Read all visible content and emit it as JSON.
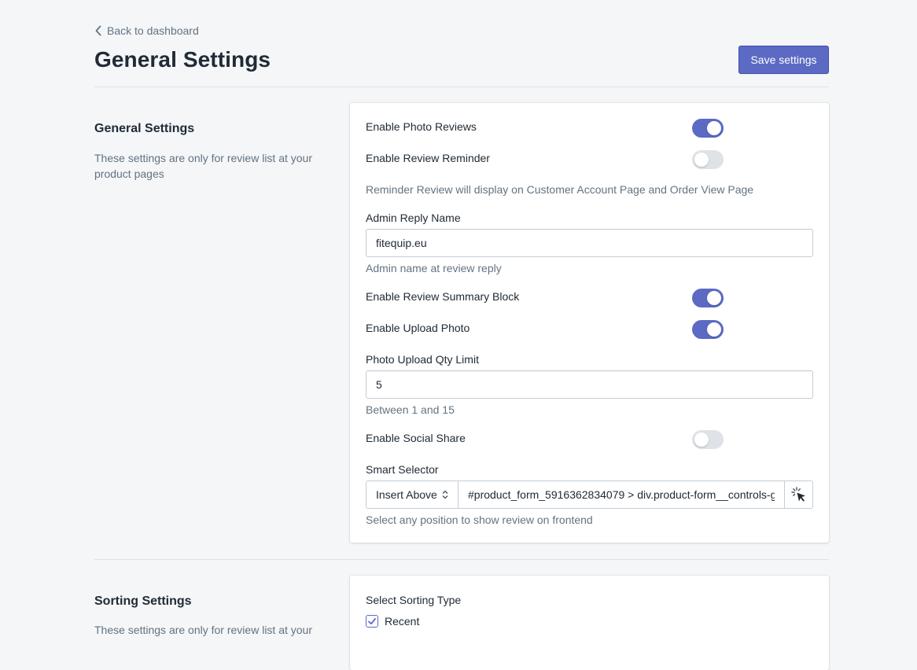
{
  "header": {
    "back_label": "Back to dashboard",
    "title": "General Settings",
    "save_label": "Save settings"
  },
  "general": {
    "title": "General Settings",
    "description": "These settings are only for review list at your product pages",
    "enable_photo_reviews": {
      "label": "Enable Photo Reviews",
      "on": true
    },
    "enable_review_reminder": {
      "label": "Enable Review Reminder",
      "on": false
    },
    "reminder_help": "Reminder Review will display on Customer Account Page and Order View Page",
    "admin_reply_name": {
      "label": "Admin Reply Name",
      "value": "fitequip.eu",
      "help": "Admin name at review reply"
    },
    "enable_summary_block": {
      "label": "Enable Review Summary Block",
      "on": true
    },
    "enable_upload_photo": {
      "label": "Enable Upload Photo",
      "on": true
    },
    "photo_qty_limit": {
      "label": "Photo Upload Qty Limit",
      "value": "5",
      "help": "Between 1 and 15"
    },
    "enable_social_share": {
      "label": "Enable Social Share",
      "on": false
    },
    "smart_selector": {
      "label": "Smart Selector",
      "position": "Insert Above",
      "value": "#product_form_5916362834079 > div.product-form__controls-g",
      "help": "Select any position to show review on frontend"
    }
  },
  "sorting": {
    "title": "Sorting Settings",
    "description": "These settings are only for review list at your",
    "select_label": "Select Sorting Type",
    "options": [
      {
        "label": "Recent",
        "checked": true
      }
    ]
  },
  "colors": {
    "accent": "#5c6ac4",
    "toggle_off": "#dfe3e8",
    "muted_text": "#637381"
  }
}
